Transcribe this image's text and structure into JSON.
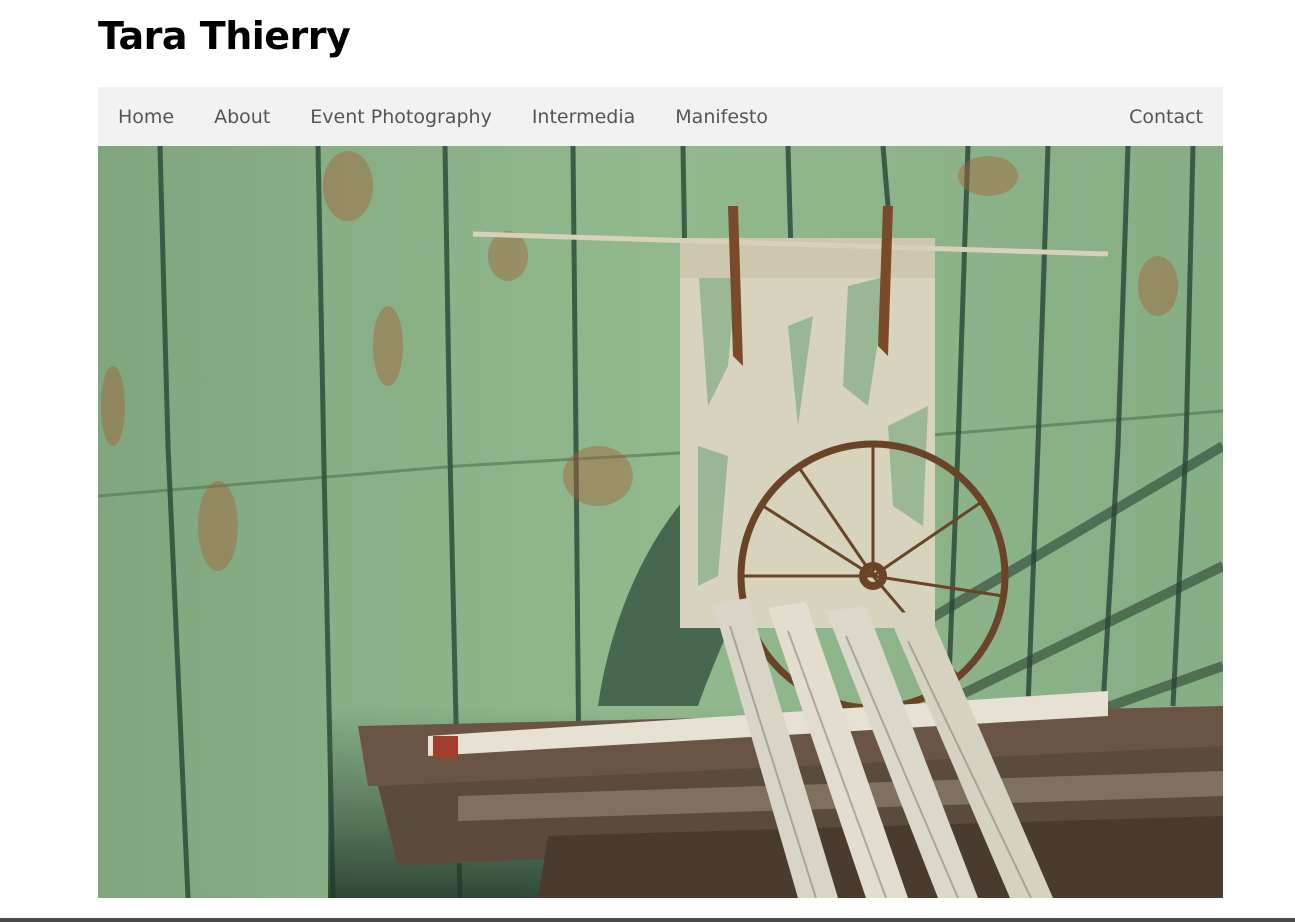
{
  "site": {
    "title": "Tara Thierry"
  },
  "nav": {
    "items": [
      {
        "label": "Home"
      },
      {
        "label": "About"
      },
      {
        "label": "Event Photography"
      },
      {
        "label": "Intermedia"
      },
      {
        "label": "Manifesto"
      }
    ],
    "contact": {
      "label": "Contact"
    }
  },
  "colors": {
    "nav_background": "#f2f2f2",
    "nav_text": "#555555",
    "title_text": "#000000",
    "wall_green": "#8ab187",
    "rust": "#a4623a"
  },
  "hero_image": {
    "icon": "photo-image"
  }
}
